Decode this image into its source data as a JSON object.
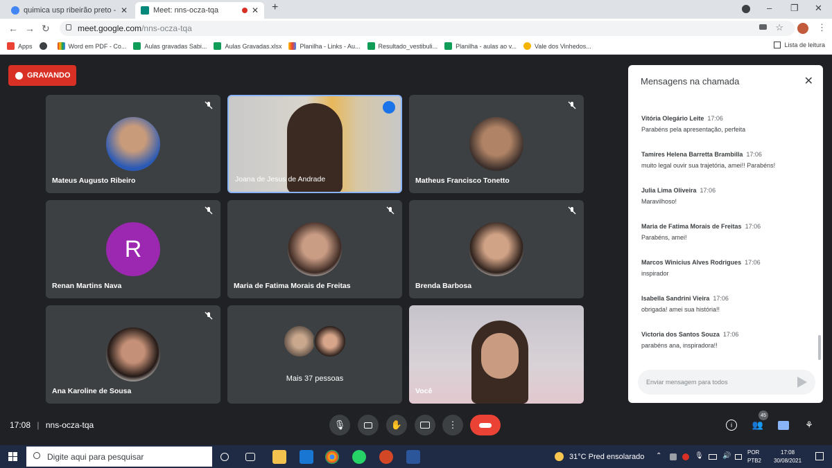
{
  "browser": {
    "tabs": [
      {
        "title": "quimica usp ribeirão preto - Pes",
        "close": "✕"
      },
      {
        "title": "Meet: nns-ocza-tqa",
        "close": "✕"
      }
    ],
    "new_tab": "+",
    "window_controls": {
      "minimize": "–",
      "maximize": "❐",
      "close": "✕"
    },
    "nav": {
      "back": "←",
      "forward": "→",
      "reload": "↻"
    },
    "url_host": "meet.google.com",
    "url_path": "/nns-ocza-tqa",
    "bookmarks": [
      {
        "label": "Apps",
        "color": "#ea4335"
      },
      {
        "label": "",
        "color": "#3c4043"
      },
      {
        "label": "Word em PDF - Co...",
        "color": "#d93025"
      },
      {
        "label": "Aulas gravadas Sabi...",
        "color": "#0f9d58"
      },
      {
        "label": "Aulas Gravadas.xlsx",
        "color": "#0f9d58"
      },
      {
        "label": "Planilha - Links - Au...",
        "color": "#fbbc04"
      },
      {
        "label": "Resultado_vestibuli...",
        "color": "#0f9d58"
      },
      {
        "label": "Planilha - aulas ao v...",
        "color": "#0f9d58"
      },
      {
        "label": "Vale dos Vinhedos...",
        "color": "#f4b400"
      }
    ],
    "reading_list": "Lista de leitura"
  },
  "meet": {
    "recording_label": "GRAVANDO",
    "meeting_code": "nns-ocza-tqa",
    "time": "17:08",
    "participants": [
      {
        "name": "Mateus Augusto Ribeiro",
        "type": "avatar-photo"
      },
      {
        "name": "Joana de Jesus de Andrade",
        "type": "video",
        "speaking": true
      },
      {
        "name": "Matheus Francisco Tonetto",
        "type": "avatar-photo"
      },
      {
        "name": "Renan Martins Nava",
        "type": "avatar-letter",
        "letter": "R"
      },
      {
        "name": "Maria de Fatima Morais de Freitas",
        "type": "avatar-photo"
      },
      {
        "name": "Brenda Barbosa",
        "type": "avatar-photo"
      },
      {
        "name": "Ana Karoline de Sousa",
        "type": "avatar-photo"
      },
      {
        "name": "Mais 37 pessoas",
        "type": "group"
      },
      {
        "name": "Você",
        "type": "video"
      }
    ],
    "participant_count_badge": "45",
    "chat": {
      "title": "Mensagens na chamada",
      "close": "✕",
      "messages": [
        {
          "sender": "Vitória Olegário Leite",
          "time": "17:06",
          "text": "Parabéns pela apresentação, perfeita"
        },
        {
          "sender": "Tamires Helena Barretta Brambilla",
          "time": "17:06",
          "text": "muito legal ouvir sua trajetória, amei!! Parabéns!"
        },
        {
          "sender": "Julia Lima Oliveira",
          "time": "17:06",
          "text": "Maravilhoso!"
        },
        {
          "sender": "Maria de Fatima Morais de Freitas",
          "time": "17:06",
          "text": "Parabéns, amei!"
        },
        {
          "sender": "Marcos Winicius Alves Rodrigues",
          "time": "17:06",
          "text": "inspirador"
        },
        {
          "sender": "Isabella Sandrini Vieira",
          "time": "17:06",
          "text": "obrigada! amei sua história!!"
        },
        {
          "sender": "Victoria dos Santos Souza",
          "time": "17:06",
          "text": "parabéns ana, inspiradora!!"
        }
      ],
      "input_placeholder": "Enviar mensagem para todos"
    }
  },
  "taskbar": {
    "search_placeholder": "Digite aqui para pesquisar",
    "weather": "31°C  Pred ensolarado",
    "lang": "POR",
    "lang2": "PTB2",
    "time": "17:08",
    "date": "30/08/2021"
  }
}
